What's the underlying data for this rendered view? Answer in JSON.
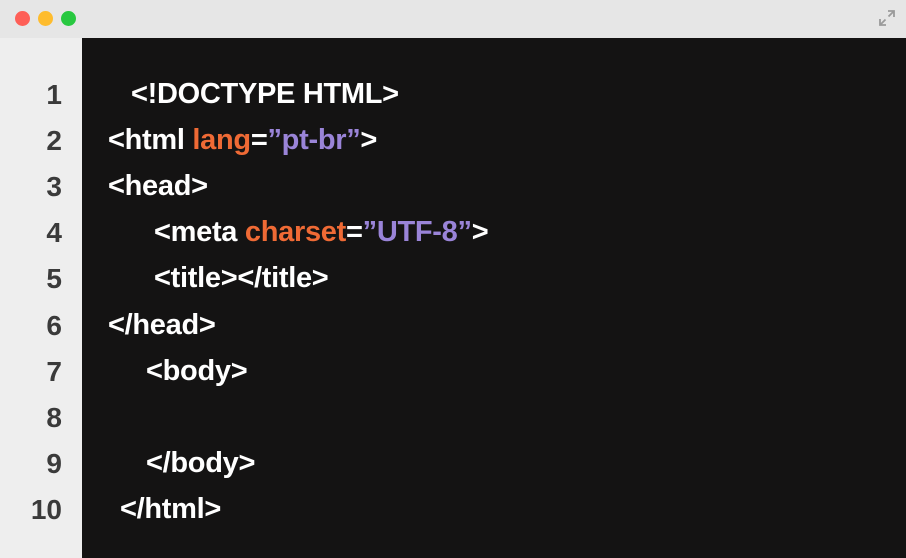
{
  "colors": {
    "editor_bg": "#141313",
    "gutter_bg": "#eeeeee",
    "tag": "#ffffff",
    "attribute": "#ef6a35",
    "string": "#9a84d8",
    "close_button": "#fe5f57",
    "minimize_button": "#febc2e",
    "maximize_button": "#28c840"
  },
  "icons": {
    "expand": "expand-arrows-icon"
  },
  "line_numbers": [
    "1",
    "2",
    "3",
    "4",
    "5",
    "6",
    "7",
    "8",
    "9",
    "10"
  ],
  "code": {
    "l1": {
      "text": "<!DOCTYPE HTML>"
    },
    "l2": {
      "open": "<html ",
      "attr": "lang",
      "eq": "=",
      "value": "”pt-br”",
      "close": ">"
    },
    "l3": {
      "text": "<head>"
    },
    "l4": {
      "open": "<meta ",
      "attr": "charset",
      "eq": "=",
      "value": "”UTF-8”",
      "close": ">"
    },
    "l5": {
      "text": "<title></title>"
    },
    "l6": {
      "text": "</head>"
    },
    "l7": {
      "text": "<body>"
    },
    "l8": {
      "text": ""
    },
    "l9": {
      "text": "</body>"
    },
    "l10": {
      "text": "</html>"
    }
  }
}
